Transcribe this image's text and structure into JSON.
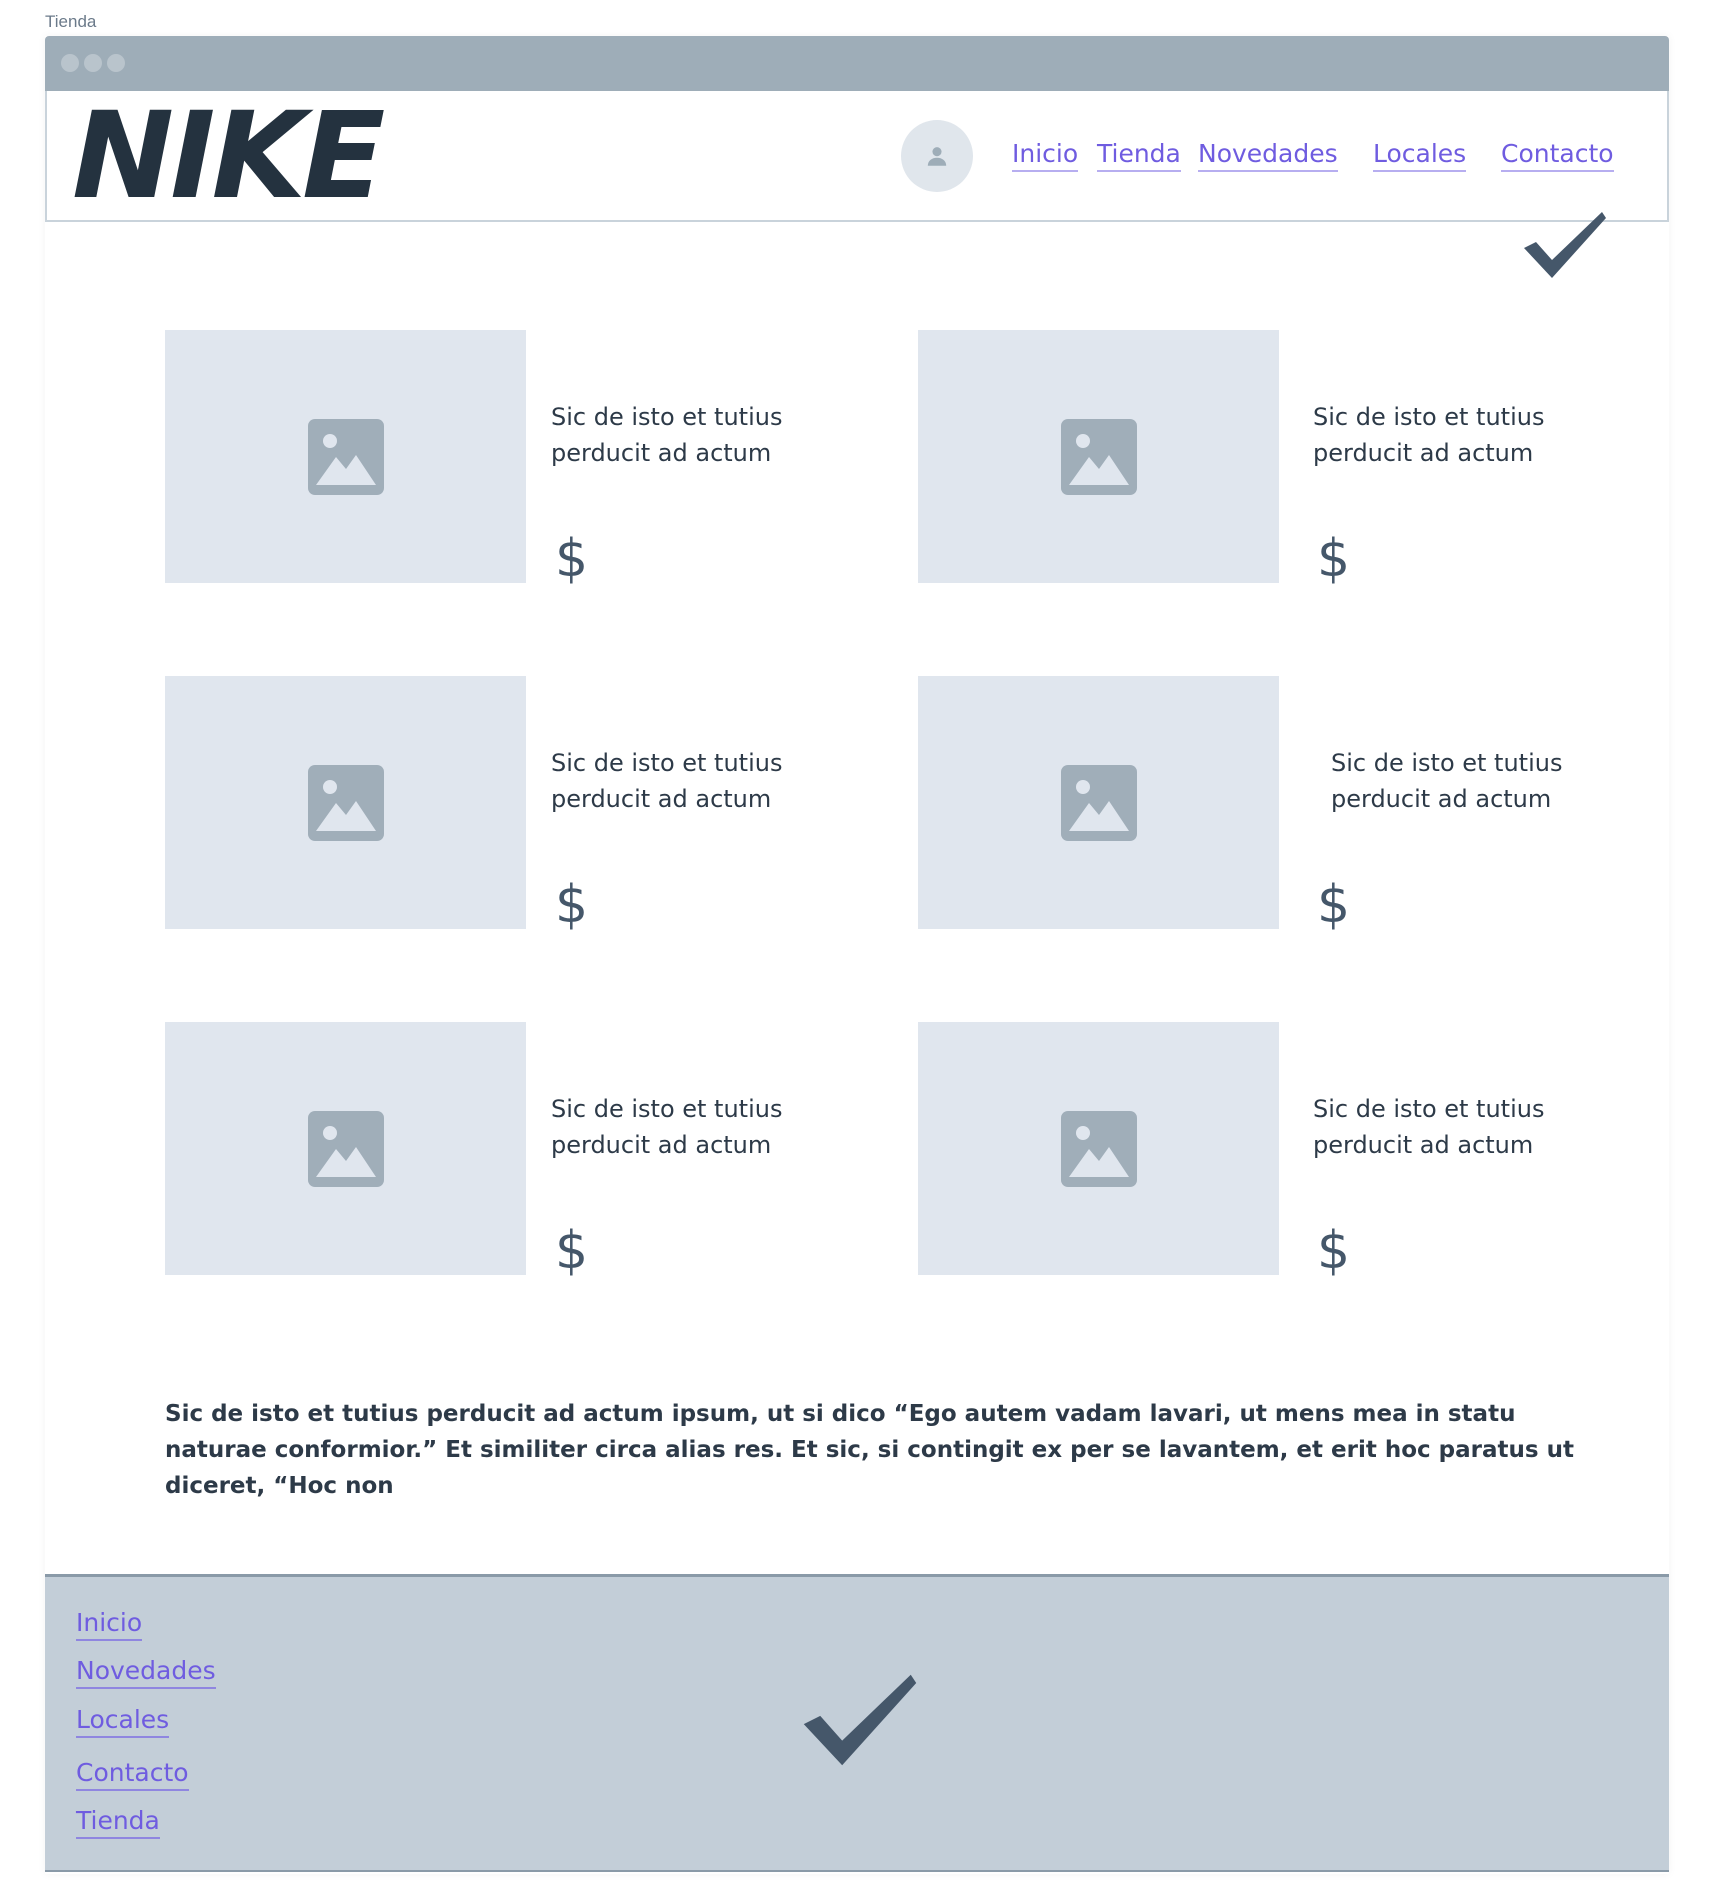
{
  "page": {
    "label": "Tienda"
  },
  "header": {
    "logo": "NIKE",
    "nav": [
      "Inicio",
      "Tienda",
      "Novedades",
      "Locales",
      "Contacto"
    ]
  },
  "products": [
    {
      "description": "Sic de isto et tutius perducit ad actum",
      "price": "$"
    },
    {
      "description": "Sic de isto et tutius perducit ad actum",
      "price": "$"
    },
    {
      "description": "Sic de isto et tutius perducit ad actum",
      "price": "$"
    },
    {
      "description": "Sic de isto et tutius perducit ad actum",
      "price": "$"
    },
    {
      "description": "Sic de isto et tutius perducit ad actum",
      "price": "$"
    },
    {
      "description": "Sic de isto et tutius perducit ad actum",
      "price": "$"
    }
  ],
  "body_text": "Sic de isto et tutius perducit ad actum ipsum, ut si dico “Ego autem vadam lavari, ut mens mea in statu naturae conformior.” Et similiter circa alias res. Et sic, si contingit ex per se lavantem, et erit hoc paratus ut diceret, “Hoc non",
  "footer": {
    "links": [
      "Inicio",
      "Novedades",
      "Locales",
      "Contacto",
      "Tienda"
    ]
  },
  "icons": {
    "avatar": "user-icon",
    "product_image": "image-placeholder-icon",
    "checkmark": "checkmark-icon"
  },
  "colors": {
    "link": "#6f5ce0",
    "titlebar": "#9eadb8",
    "footer_bg": "#c3ced8",
    "placeholder_bg": "#e0e6ee",
    "logo": "#24323f"
  }
}
